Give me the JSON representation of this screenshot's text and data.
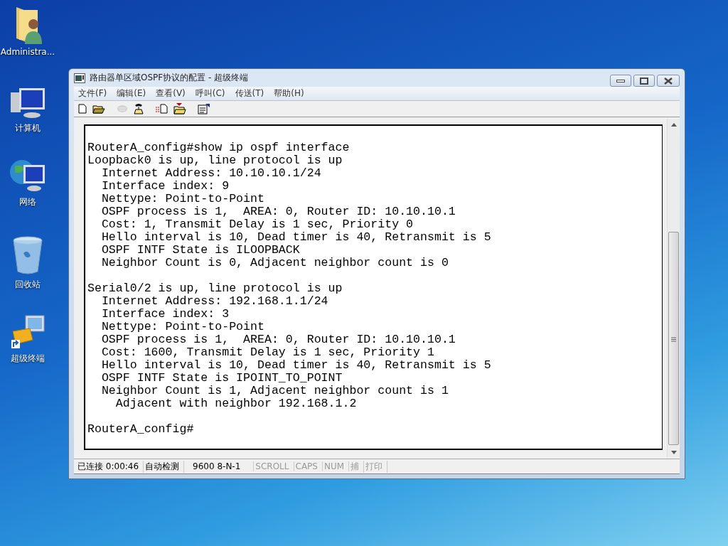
{
  "desktop_icons": [
    {
      "label": "Administra...",
      "kind": "user-folder"
    },
    {
      "label": "计算机",
      "kind": "computer"
    },
    {
      "label": "网络",
      "kind": "network"
    },
    {
      "label": "回收站",
      "kind": "recycle"
    },
    {
      "label": "超级终端",
      "kind": "terminal"
    }
  ],
  "window": {
    "title": "路由器单区域OSPF协议的配置 - 超级终端"
  },
  "menu": [
    "文件(F)",
    "编辑(E)",
    "查看(V)",
    "呼叫(C)",
    "传送(T)",
    "帮助(H)"
  ],
  "toolbar": [
    {
      "kind": "new",
      "disabled": false
    },
    {
      "kind": "open",
      "disabled": false
    },
    {
      "kind": "call",
      "disabled": true
    },
    {
      "kind": "disconnect",
      "disabled": false
    },
    {
      "kind": "send",
      "disabled": false
    },
    {
      "kind": "receive",
      "disabled": false
    },
    {
      "kind": "properties",
      "disabled": false
    }
  ],
  "terminal_blocks": [
    [
      "RouterA_config#show ip ospf interface",
      "Loopback0 is up, line protocol is up",
      "  Internet Address: 10.10.10.1/24",
      "  Interface index: 9",
      "  Nettype: Point-to-Point",
      "  OSPF process is 1,  AREA: 0, Router ID: 10.10.10.1",
      "  Cost: 1, Transmit Delay is 1 sec, Priority 0",
      "  Hello interval is 10, Dead timer is 40, Retransmit is 5",
      "  OSPF INTF State is ILOOPBACK",
      "  Neighbor Count is 0, Adjacent neighbor count is 0"
    ],
    [
      "Serial0/2 is up, line protocol is up",
      "  Internet Address: 192.168.1.1/24",
      "  Interface index: 3",
      "  Nettype: Point-to-Point",
      "  OSPF process is 1,  AREA: 0, Router ID: 10.10.10.1",
      "  Cost: 1600, Transmit Delay is 1 sec, Priority 1",
      "  Hello interval is 10, Dead timer is 40, Retransmit is 5",
      "  OSPF INTF State is IPOINT_TO_POINT",
      "  Neighbor Count is 1, Adjacent neighbor count is 1",
      "    Adjacent with neighbor 192.168.1.2"
    ],
    [
      "RouterA_config#"
    ]
  ],
  "status_bar": [
    {
      "text": "已连接 0:00:46",
      "disabled": false
    },
    {
      "text": "自动检测",
      "disabled": false
    },
    {
      "text": "9600 8-N-1",
      "disabled": false
    },
    {
      "text": "SCROLL",
      "disabled": true
    },
    {
      "text": "CAPS",
      "disabled": true
    },
    {
      "text": "NUM",
      "disabled": true
    },
    {
      "text": "捕",
      "disabled": true
    },
    {
      "text": "打印",
      "disabled": true
    }
  ]
}
